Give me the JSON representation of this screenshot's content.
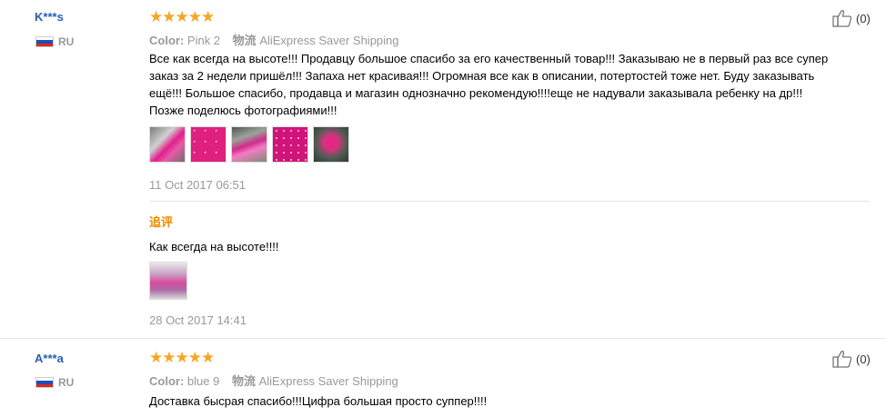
{
  "reviews": [
    {
      "user": "K***s",
      "country": "RU",
      "rating": "★★★★★",
      "color_label": "Color:",
      "color_value": "Pink 2",
      "shipping_label": "物流",
      "shipping_value": "AliExpress Saver Shipping",
      "text": "Все как всегда на высоте!!! Продавцу большое спасибо за его качественный товар!!! Заказываю не в первый раз все супер заказ за 2 недели пришёл!!! Запаха нет красивая!!! Огромная все как в описании, потертостей тоже нет. Буду заказывать ещё!!! Большое спасибо, продавца и магазин однозначно рекомендую!!!!еще не надували заказывала ребенку на др!!! Позже поделюсь фотографиями!!!",
      "photos": [
        "photo-1",
        "photo-2",
        "photo-3",
        "photo-4",
        "photo-5"
      ],
      "date": "11 Oct 2017 06:51",
      "followup_label": "追评",
      "followup_text": "Как всегда на высоте!!!!",
      "followup_photos": [
        "photo-6"
      ],
      "followup_date": "28 Oct 2017 14:41",
      "likes": "(0)"
    },
    {
      "user": "A***a",
      "country": "RU",
      "rating": "★★★★★",
      "color_label": "Color:",
      "color_value": "blue 9",
      "shipping_label": "物流",
      "shipping_value": "AliExpress Saver Shipping",
      "text": "Доставка бысрая спасибо!!!Цифра большая просто суппер!!!!",
      "likes": "(0)"
    }
  ],
  "colors": {
    "accent_blue": "#2a5db0",
    "star": "#f6a623",
    "followup": "#f08c00"
  },
  "icons": {
    "like": "thumbs-up-icon",
    "flag": "russia-flag-icon"
  }
}
